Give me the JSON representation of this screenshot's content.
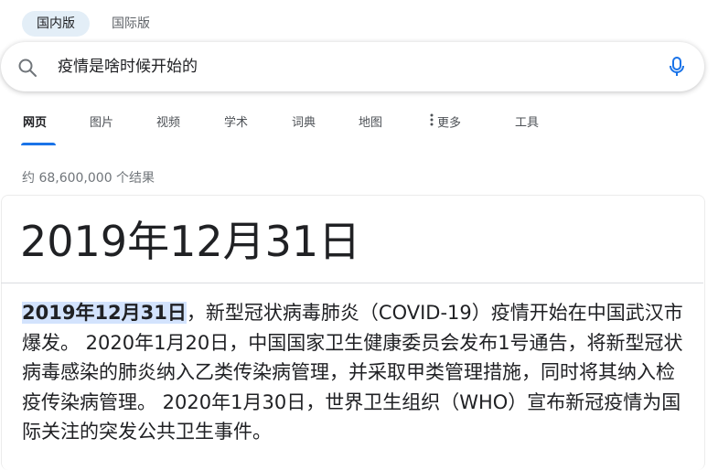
{
  "region_tabs": [
    {
      "label": "国内版"
    },
    {
      "label": "国际版"
    }
  ],
  "search": {
    "value": "疫情是啥时候开始的"
  },
  "nav": {
    "items": [
      {
        "label": "网页"
      },
      {
        "label": "图片"
      },
      {
        "label": "视频"
      },
      {
        "label": "学术"
      },
      {
        "label": "词典"
      },
      {
        "label": "地图"
      },
      {
        "label": "更多"
      },
      {
        "label": "工具"
      }
    ]
  },
  "results": {
    "stats": "约 68,600,000 个结果"
  },
  "answer": {
    "headline": "2019年12月31日",
    "snippet_highlight": "2019年12月31日",
    "snippet_rest": "，新型冠状病毒肺炎（COVID-19）疫情开始在中国武汉市爆发。 2020年1月20日，中国国家卫生健康委员会发布1号通告，将新型冠状病毒感染的肺炎纳入乙类传染病管理，并采取甲类管理措施，同时将其纳入检疫传染病管理。 2020年1月30日，世界卫生组织（WHO）宣布新冠疫情为国际关注的突发公共卫生事件。"
  },
  "colors": {
    "accent": "#1a73e8",
    "highlight": "#d3e3fd",
    "active_region_bg": "#e3eef7"
  },
  "icons": [
    "search-icon",
    "mic-icon",
    "more-dots-icon"
  ]
}
